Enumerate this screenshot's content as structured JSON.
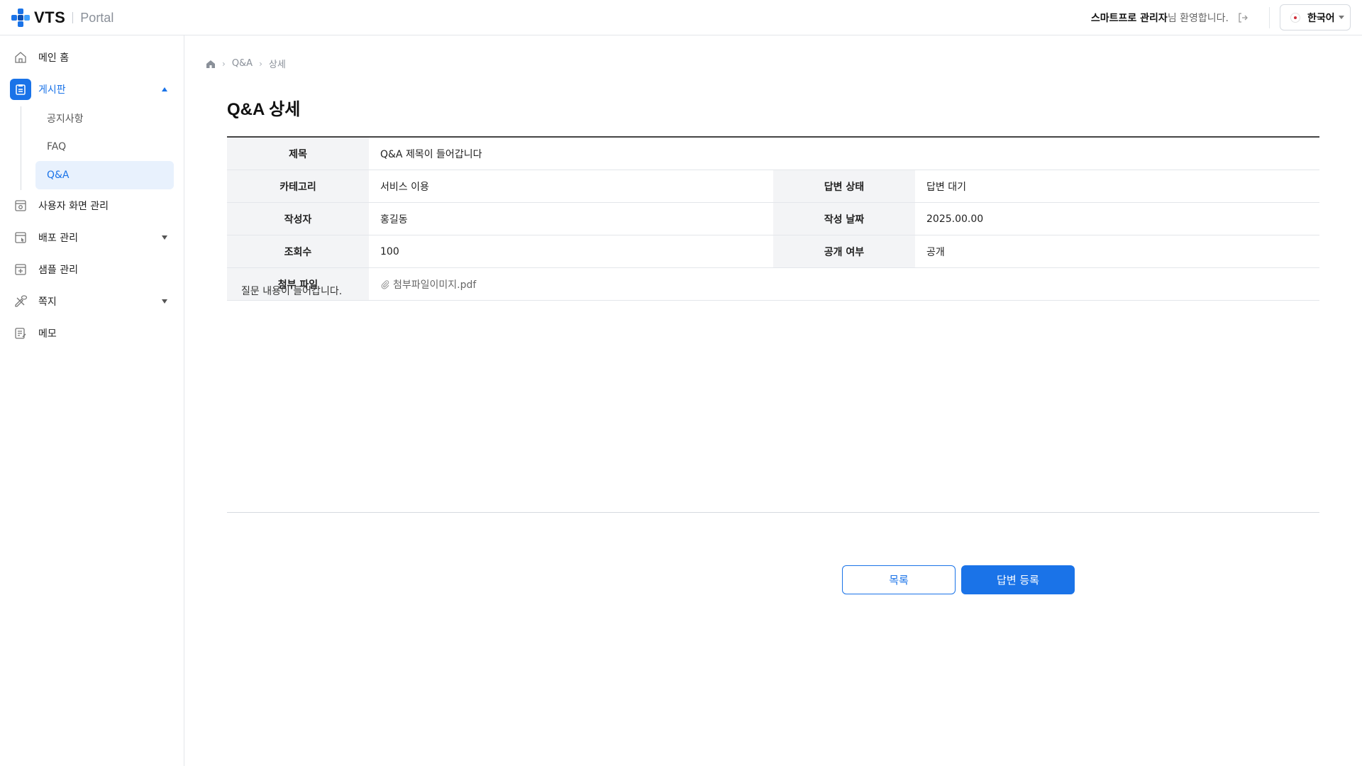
{
  "header": {
    "logo_text": "VTS",
    "logo_sub": "Portal",
    "welcome_name": "스마트프로 관리자",
    "welcome_suffix": "님 환영합니다.",
    "language": "한국어",
    "brand_color": "#1a73e8"
  },
  "sidebar": {
    "items": [
      {
        "label": "메인 홈",
        "icon": "home-icon"
      },
      {
        "label": "게시판",
        "icon": "board-icon"
      },
      {
        "label": "사용자 화면 관리",
        "icon": "screen-settings-icon"
      },
      {
        "label": "배포 관리",
        "icon": "deploy-icon"
      },
      {
        "label": "샘플 관리",
        "icon": "sample-icon"
      },
      {
        "label": "쪽지",
        "icon": "message-icon"
      },
      {
        "label": "메모",
        "icon": "memo-icon"
      }
    ],
    "board_sub": [
      {
        "label": "공지사항"
      },
      {
        "label": "FAQ"
      },
      {
        "label": "Q&A"
      }
    ]
  },
  "breadcrumb": [
    "Q&A",
    "상세"
  ],
  "page_title": "Q&A 상세",
  "detail": {
    "title_label": "제목",
    "title_value": "Q&A 제목이 들어갑니다",
    "category_label": "카테고리",
    "category_value": "서비스 이용",
    "status_label": "답변 상태",
    "status_value": "답변 대기",
    "author_label": "작성자",
    "author_value": "홍길동",
    "date_label": "작성 날짜",
    "date_value": "2025.00.00",
    "views_label": "조회수",
    "views_value": "100",
    "public_label": "공개 여부",
    "public_value": "공개",
    "attach_label": "첨부 파일",
    "attach_value": "첨부파일이미지.pdf"
  },
  "content": "질문 내용이 들어갑니다.",
  "buttons": {
    "list": "목록",
    "answer": "답변 등록"
  }
}
